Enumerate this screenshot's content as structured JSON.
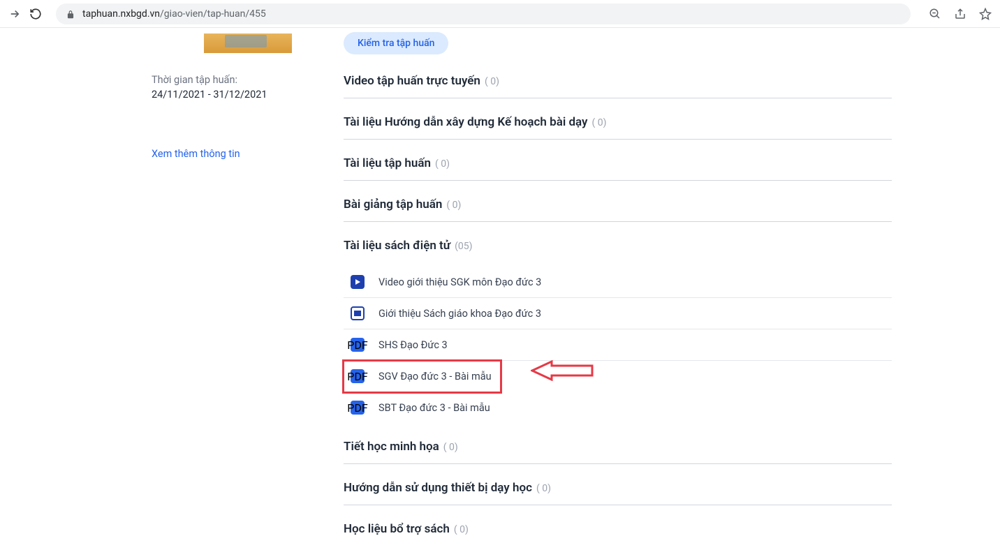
{
  "browser": {
    "url_domain": "taphuan.nxbgd.vn",
    "url_path": "/giao-vien/tap-huan/455"
  },
  "sidebar": {
    "time_label": "Thời gian tập huấn:",
    "time_value": "24/11/2021 - 31/12/2021",
    "view_more": "Xem thêm thông tin"
  },
  "main": {
    "action_button_label": "Kiểm tra tập huấn",
    "sections": [
      {
        "title": "Video tập huấn trực tuyến",
        "count": "( 0)"
      },
      {
        "title": "Tài liệu Hướng dẫn xây dựng Kế hoạch bài dạy",
        "count": "( 0)"
      },
      {
        "title": "Tài liệu tập huấn",
        "count": "( 0)"
      },
      {
        "title": "Bài giảng tập huấn",
        "count": "( 0)"
      },
      {
        "title": "Tài liệu sách điện tử",
        "count": "(05)"
      },
      {
        "title": "Tiết học minh họa",
        "count": "( 0)"
      },
      {
        "title": "Hướng dẫn sử dụng thiết bị dạy học",
        "count": "( 0)"
      },
      {
        "title": "Học liệu bổ trợ sách",
        "count": "( 0)"
      }
    ],
    "resources": [
      {
        "icon": "video",
        "label": "Video giới thiệu SGK môn Đạo đức 3"
      },
      {
        "icon": "slide",
        "label": "Giới thiệu Sách giáo khoa Đạo đức 3"
      },
      {
        "icon": "pdf",
        "label": "SHS Đạo Đức 3"
      },
      {
        "icon": "pdf",
        "label": "SGV Đạo đức 3 - Bài mẫu",
        "highlighted": true
      },
      {
        "icon": "pdf",
        "label": "SBT Đạo đức 3 - Bài mẫu"
      }
    ],
    "pdf_badge": "PDF"
  }
}
